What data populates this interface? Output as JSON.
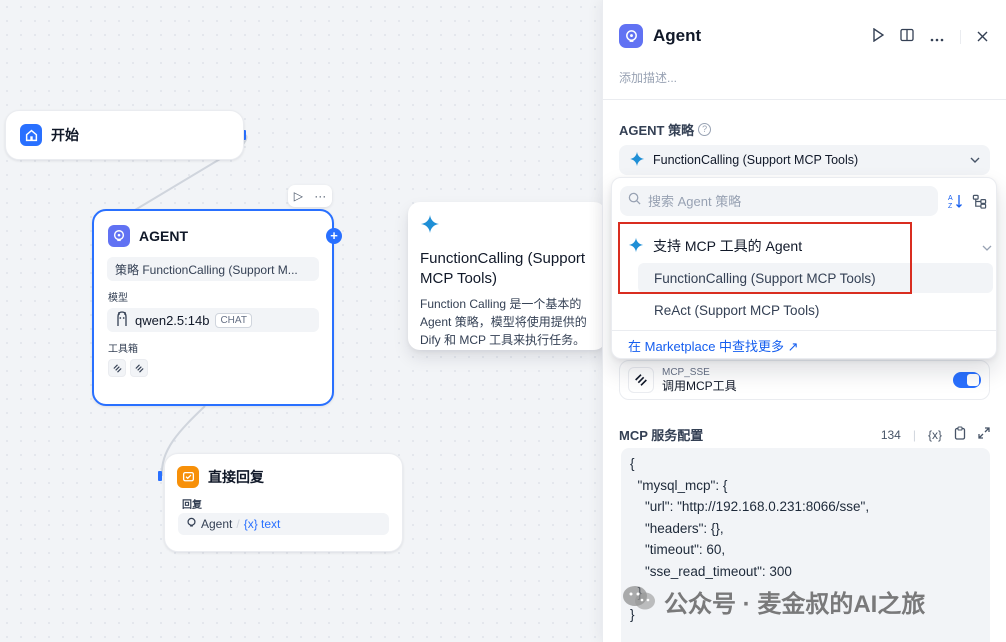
{
  "canvas": {
    "start_node": {
      "title": "开始"
    },
    "agent_node": {
      "title": "AGENT",
      "strategy_text": "策略 FunctionCalling (Support M...",
      "model_label": "模型",
      "model_name": "qwen2.5:14b",
      "model_tag": "CHAT",
      "tools_label": "工具箱"
    },
    "reply_node": {
      "title": "直接回复",
      "label": "回复",
      "var_source": "Agent",
      "var_sep": "/",
      "var_name": "{x} text"
    },
    "tooltip": {
      "title": "FunctionCalling (Support MCP Tools)",
      "description": "Function Calling 是一个基本的 Agent 策略，模型将使用提供的 Dify 和 MCP 工具来执行任务。"
    },
    "mini_toolbar": {
      "run": "▷",
      "more": "···"
    },
    "plus": "+"
  },
  "panel": {
    "title": "Agent",
    "description_placeholder": "添加描述...",
    "strategy_label": "AGENT 策略",
    "strategy_value": "FunctionCalling (Support MCP Tools)",
    "tool": {
      "provider": "MCP_SSE",
      "name": "调用MCP工具",
      "enabled": true
    },
    "mcp": {
      "title": "MCP 服务配置",
      "count": "134",
      "var_btn": "{x}",
      "code": "{\n  \"mysql_mcp\": {\n    \"url\": \"http://192.168.0.231:8066/sse\",\n    \"headers\": {},\n    \"timeout\": 60,\n    \"sse_read_timeout\": 300\n  }\n}"
    }
  },
  "dropdown": {
    "search_placeholder": "搜索 Agent 策略",
    "group_label": "支持 MCP 工具的 Agent",
    "items": [
      {
        "label": "FunctionCalling (Support MCP Tools)",
        "active": true
      },
      {
        "label": "ReAct (Support MCP Tools)",
        "active": false
      }
    ],
    "footer_link": "在 Marketplace 中查找更多 ↗"
  },
  "watermark": "公众号 · 麦金叔的AI之旅",
  "colors": {
    "accent": "#2970ff",
    "agent_icon": "#6172f3",
    "start_icon": "#2970ff",
    "reply_icon": "#f79009",
    "highlight": "#d92d20"
  }
}
